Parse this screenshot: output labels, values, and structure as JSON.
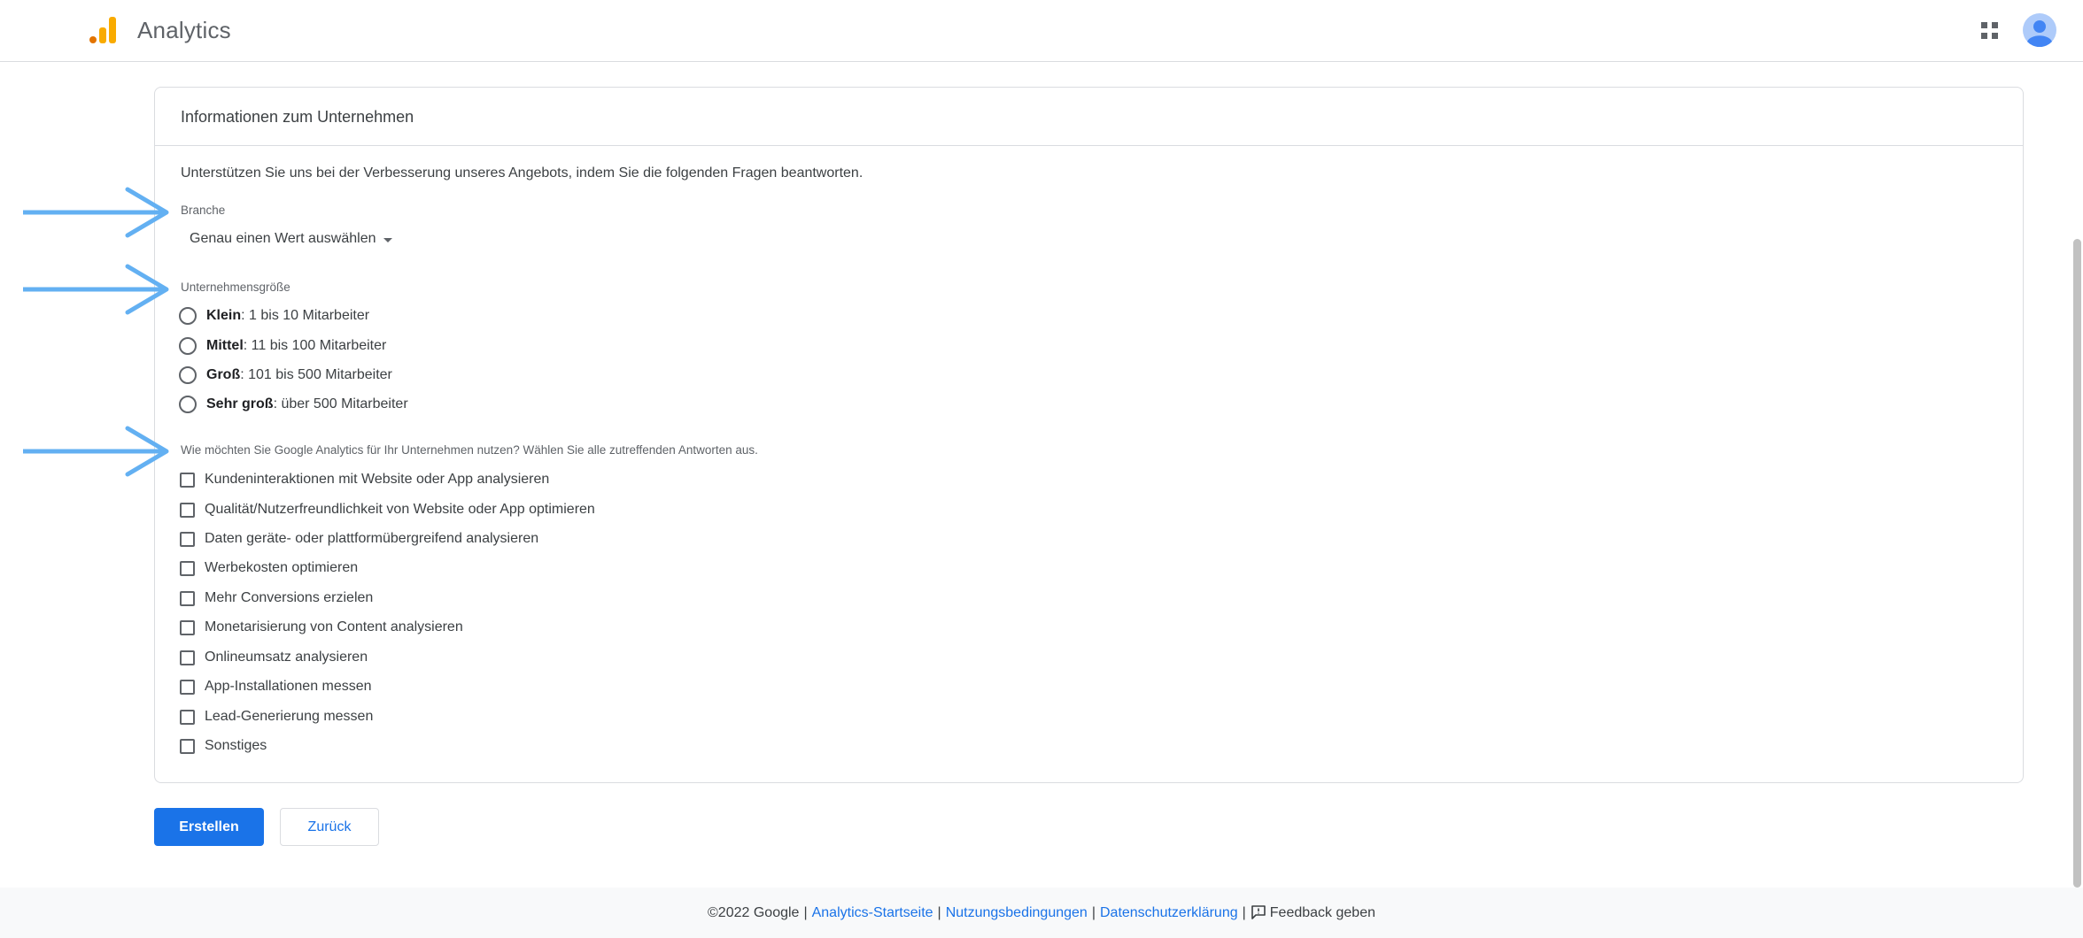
{
  "header": {
    "app_title": "Analytics",
    "logo_colors": [
      "#f9ab00",
      "#e37400"
    ],
    "apps_icon": "apps-grid-icon",
    "avatar_icon": "account-avatar-icon",
    "avatar_color": "#5b8ee6"
  },
  "card": {
    "title": "Informationen zum Unternehmen",
    "intro": "Unterstützen Sie uns bei der Verbesserung unseres Angebots, indem Sie die folgenden Fragen beantworten.",
    "branche": {
      "label": "Branche",
      "selected": "Genau einen Wert auswählen"
    },
    "size": {
      "label": "Unternehmensgröße",
      "options": [
        {
          "bold": "Klein",
          "rest": ": 1 bis 10 Mitarbeiter"
        },
        {
          "bold": "Mittel",
          "rest": ": 11 bis 100 Mitarbeiter"
        },
        {
          "bold": "Groß",
          "rest": ": 101 bis 500 Mitarbeiter"
        },
        {
          "bold": "Sehr groß",
          "rest": ": über 500 Mitarbeiter"
        }
      ]
    },
    "usage": {
      "label": "Wie möchten Sie Google Analytics für Ihr Unternehmen nutzen? Wählen Sie alle zutreffenden Antworten aus.",
      "options": [
        "Kundeninteraktionen mit Website oder App analysieren",
        "Qualität/Nutzerfreundlichkeit von Website oder App optimieren",
        "Daten geräte- oder plattformübergreifend analysieren",
        "Werbekosten optimieren",
        "Mehr Conversions erzielen",
        "Monetarisierung von Content analysieren",
        "Onlineumsatz analysieren",
        "App-Installationen messen",
        "Lead-Generierung messen",
        "Sonstiges"
      ]
    }
  },
  "buttons": {
    "create": "Erstellen",
    "back": "Zurück"
  },
  "footer": {
    "copyright": "©2022 Google",
    "link1": "Analytics-Startseite",
    "link2": "Nutzungsbedingungen",
    "link3": "Datenschutzerklärung",
    "feedback": "Feedback geben",
    "separator": "|",
    "link_color": "#1a73e8"
  },
  "annotations": {
    "arrow_color": "#63b0f2"
  }
}
